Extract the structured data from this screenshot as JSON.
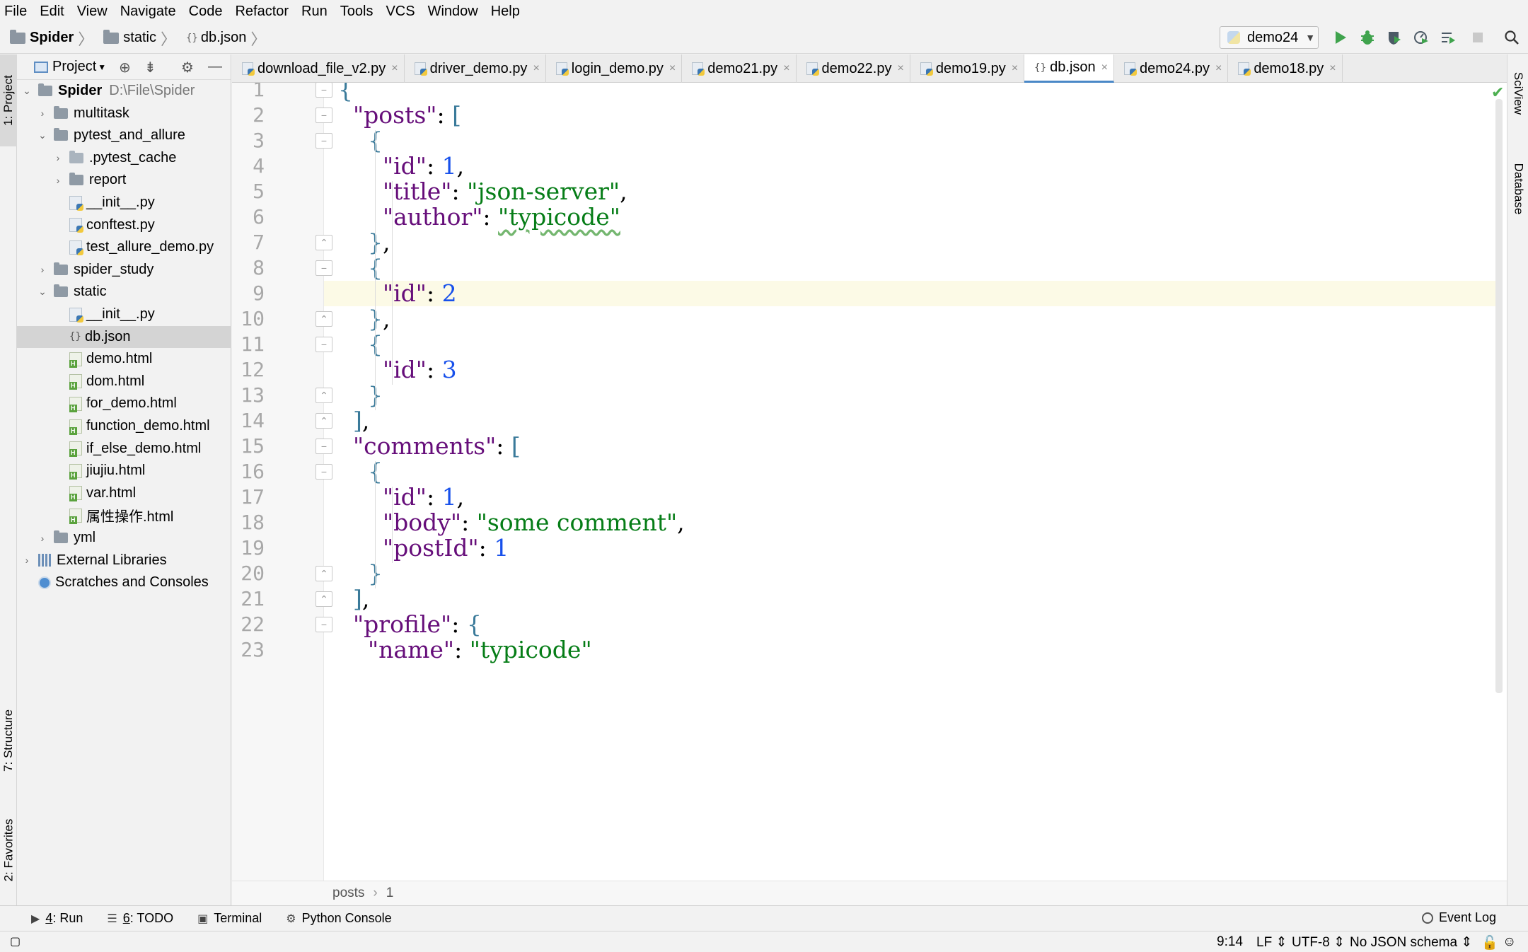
{
  "menu": [
    "File",
    "Edit",
    "View",
    "Navigate",
    "Code",
    "Refactor",
    "Run",
    "Tools",
    "VCS",
    "Window",
    "Help"
  ],
  "breadcrumb": [
    "Spider",
    "static",
    "db.json"
  ],
  "toolbar": {
    "run_config": "demo24",
    "icons": [
      "run-icon",
      "debug-icon",
      "coverage-icon",
      "profile-icon",
      "run-list-icon",
      "stop-icon",
      "search-icon"
    ]
  },
  "left_strip": {
    "project": "1: Project",
    "structure": "7: Structure",
    "favorites": "2: Favorites"
  },
  "right_strip": {
    "sciview": "SciView",
    "database": "Database"
  },
  "project": {
    "header": "Project",
    "tree": [
      {
        "label": "Spider",
        "hint": "D:\\File\\Spider",
        "type": "root-folder",
        "depth": 0,
        "expanded": true
      },
      {
        "label": "multitask",
        "type": "folder",
        "depth": 1,
        "expanded": false
      },
      {
        "label": "pytest_and_allure",
        "type": "folder",
        "depth": 1,
        "expanded": true
      },
      {
        "label": ".pytest_cache",
        "type": "folder-light",
        "depth": 2,
        "expanded": false
      },
      {
        "label": "report",
        "type": "folder",
        "depth": 2,
        "expanded": false
      },
      {
        "label": "__init__.py",
        "type": "py",
        "depth": 2
      },
      {
        "label": "conftest.py",
        "type": "py",
        "depth": 2
      },
      {
        "label": "test_allure_demo.py",
        "type": "py",
        "depth": 2
      },
      {
        "label": "spider_study",
        "type": "folder",
        "depth": 1,
        "expanded": false
      },
      {
        "label": "static",
        "type": "folder",
        "depth": 1,
        "expanded": true
      },
      {
        "label": "__init__.py",
        "type": "py",
        "depth": 2
      },
      {
        "label": "db.json",
        "type": "json",
        "depth": 2,
        "selected": true
      },
      {
        "label": "demo.html",
        "type": "html",
        "depth": 2
      },
      {
        "label": "dom.html",
        "type": "html",
        "depth": 2
      },
      {
        "label": "for_demo.html",
        "type": "html",
        "depth": 2
      },
      {
        "label": "function_demo.html",
        "type": "html",
        "depth": 2
      },
      {
        "label": "if_else_demo.html",
        "type": "html",
        "depth": 2
      },
      {
        "label": "jiujiu.html",
        "type": "html",
        "depth": 2
      },
      {
        "label": "var.html",
        "type": "html",
        "depth": 2
      },
      {
        "label": "属性操作.html",
        "type": "html",
        "depth": 2
      },
      {
        "label": "yml",
        "type": "folder",
        "depth": 1,
        "expanded": false
      },
      {
        "label": "External Libraries",
        "type": "lib",
        "depth": 0,
        "expanded": false
      },
      {
        "label": "Scratches and Consoles",
        "type": "scratch",
        "depth": 0
      }
    ]
  },
  "tabs": [
    {
      "label": "download_file_v2.py",
      "type": "py"
    },
    {
      "label": "driver_demo.py",
      "type": "py"
    },
    {
      "label": "login_demo.py",
      "type": "py"
    },
    {
      "label": "demo21.py",
      "type": "py"
    },
    {
      "label": "demo22.py",
      "type": "py"
    },
    {
      "label": "demo19.py",
      "type": "py"
    },
    {
      "label": "db.json",
      "type": "json",
      "active": true
    },
    {
      "label": "demo24.py",
      "type": "py"
    },
    {
      "label": "demo18.py",
      "type": "py"
    }
  ],
  "editor": {
    "current_line": 9,
    "lines": [
      [
        [
          "br",
          "{"
        ]
      ],
      [
        [
          "p",
          "  "
        ],
        [
          "k",
          "\"posts\""
        ],
        [
          "p",
          ": "
        ],
        [
          "br",
          "["
        ]
      ],
      [
        [
          "p",
          "    "
        ],
        [
          "br",
          "{"
        ]
      ],
      [
        [
          "p",
          "      "
        ],
        [
          "k",
          "\"id\""
        ],
        [
          "p",
          ": "
        ],
        [
          "n",
          "1"
        ],
        [
          "p",
          ","
        ]
      ],
      [
        [
          "p",
          "      "
        ],
        [
          "k",
          "\"title\""
        ],
        [
          "p",
          ": "
        ],
        [
          "s",
          "\"json-server\""
        ],
        [
          "p",
          ","
        ]
      ],
      [
        [
          "p",
          "      "
        ],
        [
          "k",
          "\"author\""
        ],
        [
          "p",
          ": "
        ],
        [
          "s",
          "\"typicode\"",
          "wavy"
        ]
      ],
      [
        [
          "p",
          "    "
        ],
        [
          "br",
          "}"
        ],
        [
          "p",
          ","
        ]
      ],
      [
        [
          "p",
          "    "
        ],
        [
          "br",
          "{"
        ]
      ],
      [
        [
          "p",
          "      "
        ],
        [
          "k",
          "\"id\""
        ],
        [
          "p",
          ": "
        ],
        [
          "n",
          "2"
        ]
      ],
      [
        [
          "p",
          "    "
        ],
        [
          "br",
          "}"
        ],
        [
          "p",
          ","
        ]
      ],
      [
        [
          "p",
          "    "
        ],
        [
          "br",
          "{"
        ]
      ],
      [
        [
          "p",
          "      "
        ],
        [
          "k",
          "\"id\""
        ],
        [
          "p",
          ": "
        ],
        [
          "n",
          "3"
        ]
      ],
      [
        [
          "p",
          "    "
        ],
        [
          "br",
          "}"
        ]
      ],
      [
        [
          "p",
          "  "
        ],
        [
          "br",
          "]"
        ],
        [
          "p",
          ","
        ]
      ],
      [
        [
          "p",
          "  "
        ],
        [
          "k",
          "\"comments\""
        ],
        [
          "p",
          ": "
        ],
        [
          "br",
          "["
        ]
      ],
      [
        [
          "p",
          "    "
        ],
        [
          "br",
          "{"
        ]
      ],
      [
        [
          "p",
          "      "
        ],
        [
          "k",
          "\"id\""
        ],
        [
          "p",
          ": "
        ],
        [
          "n",
          "1"
        ],
        [
          "p",
          ","
        ]
      ],
      [
        [
          "p",
          "      "
        ],
        [
          "k",
          "\"body\""
        ],
        [
          "p",
          ": "
        ],
        [
          "s",
          "\"some comment\""
        ],
        [
          "p",
          ","
        ]
      ],
      [
        [
          "p",
          "      "
        ],
        [
          "k",
          "\"postId\""
        ],
        [
          "p",
          ": "
        ],
        [
          "n",
          "1"
        ]
      ],
      [
        [
          "p",
          "    "
        ],
        [
          "br",
          "}"
        ]
      ],
      [
        [
          "p",
          "  "
        ],
        [
          "br",
          "]"
        ],
        [
          "p",
          ","
        ]
      ],
      [
        [
          "p",
          "  "
        ],
        [
          "k",
          "\"profile\""
        ],
        [
          "p",
          ": "
        ],
        [
          "br",
          "{"
        ]
      ],
      [
        [
          "p",
          "    "
        ],
        [
          "k",
          "\"name\""
        ],
        [
          "p",
          ": "
        ],
        [
          "s",
          "\"typicode\""
        ]
      ]
    ],
    "fold_markers": {
      "1": "open",
      "2": "open",
      "3": "open",
      "7": "close",
      "8": "open",
      "10": "close",
      "11": "open",
      "13": "close",
      "14": "close",
      "15": "open",
      "16": "open",
      "20": "close",
      "21": "close",
      "22": "open"
    }
  },
  "editor_breadcrumb": [
    "posts",
    "1"
  ],
  "bottom_tools": [
    {
      "label": "4: Run",
      "mnemonic": "4",
      "rest": ": Run",
      "icon": "run-icon"
    },
    {
      "label": "6: TODO",
      "mnemonic": "6",
      "rest": ": TODO",
      "icon": "todo-icon"
    },
    {
      "label": "Terminal",
      "mnemonic": "",
      "rest": "Terminal",
      "icon": "terminal-icon"
    },
    {
      "label": "Python Console",
      "mnemonic": "",
      "rest": "Python Console",
      "icon": "python-console-icon"
    }
  ],
  "event_log": "Event Log",
  "status": {
    "position": "9:14",
    "line_sep": "LF",
    "encoding": "UTF-8",
    "schema": "No JSON schema"
  }
}
